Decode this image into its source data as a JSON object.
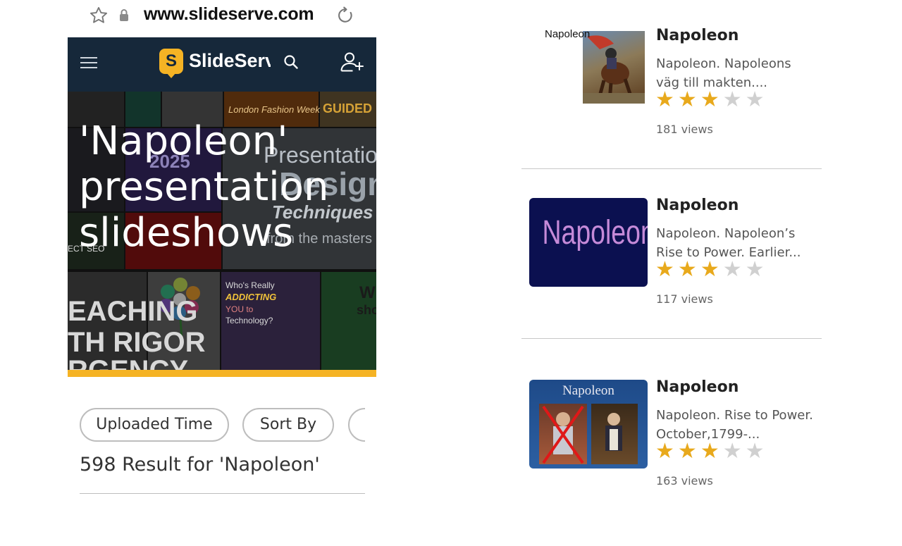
{
  "browser": {
    "url": "www.slideserve.com"
  },
  "appbar": {
    "logo_badge": "S",
    "logo_name": "SlideServe",
    "colors": {
      "bar": "#16283a",
      "accent": "#f5b324"
    },
    "icons": [
      "menu-icon",
      "search-icon",
      "add-user-icon"
    ]
  },
  "hero": {
    "title": "'Napoleon' presentation slideshows",
    "ghost_texts": [
      "London Fashion Week",
      "GUIDED RE",
      "Presentation",
      "Design",
      "Techniques",
      "from the masters",
      "2025",
      "EACHING",
      "TH RIGOR",
      "RGENCY",
      "Who's Really",
      "ADDICTING",
      "YOU to",
      "Technology?",
      "W",
      "sho",
      "ECT SEO"
    ]
  },
  "filters": {
    "uploaded_time": "Uploaded Time",
    "sort_by": "Sort By"
  },
  "results_text": "598 Result for 'Napoleon'",
  "items": [
    {
      "title": "Napoleon",
      "desc": "Napoleon. Napoleons väg till makten....",
      "rating": 3,
      "max_rating": 5,
      "views": "181 views",
      "thumb_caption": "Napoleon"
    },
    {
      "title": "Napoleon",
      "desc": "Napoleon. Napoleon’s Rise to Power. Earlier...",
      "rating": 3,
      "max_rating": 5,
      "views": "117 views",
      "thumb_caption": "Napoleon"
    },
    {
      "title": "Napoleon",
      "desc": "Napoleon. Rise to Power. October,1799-...",
      "rating": 3,
      "max_rating": 5,
      "views": "163 views",
      "thumb_caption": "Napoleon"
    }
  ]
}
